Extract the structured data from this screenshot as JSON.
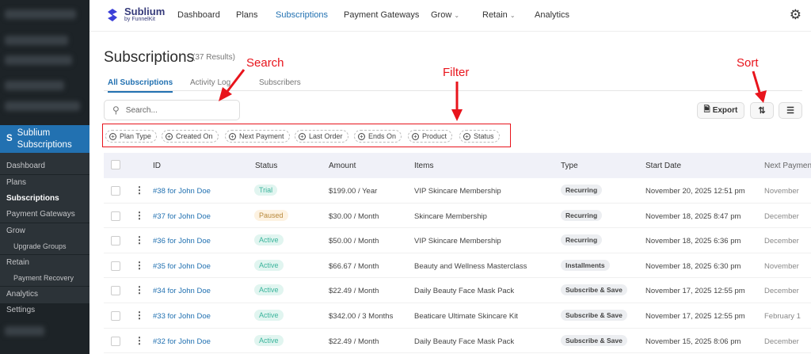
{
  "sidebar": {
    "active": "Sublium Subscriptions",
    "items": [
      "Dashboard",
      "Plans",
      "Subscriptions",
      "Payment Gateways",
      "Grow",
      "Upgrade Groups",
      "Retain",
      "Payment Recovery",
      "Analytics",
      "Settings"
    ]
  },
  "topbar": {
    "logo_name": "Sublium",
    "logo_sub": "by FunnelKit",
    "nav": [
      "Dashboard",
      "Plans",
      "Subscriptions",
      "Payment Gateways",
      "Grow",
      "Retain",
      "Analytics"
    ]
  },
  "page": {
    "title": "Subscriptions",
    "count": "(37 Results)",
    "tabs": [
      "All Subscriptions",
      "Activity Log",
      "Subscribers"
    ],
    "search_placeholder": "Search...",
    "export": "Export"
  },
  "filters": [
    "Plan Type",
    "Created On",
    "Next Payment",
    "Last Order",
    "Ends On",
    "Product",
    "Status"
  ],
  "annotations": {
    "search": "Search",
    "filter": "Filter",
    "sort": "Sort"
  },
  "table": {
    "headers": [
      "ID",
      "Status",
      "Amount",
      "Items",
      "Type",
      "Start Date",
      "Next Payment"
    ],
    "rows": [
      {
        "id": "#38 for John Doe",
        "status": "Trial",
        "amount": "$199.00 / Year",
        "items": "VIP Skincare Membership",
        "type": "Recurring",
        "start": "November 20, 2025 12:51 pm",
        "next": "November"
      },
      {
        "id": "#37 for John Doe",
        "status": "Paused",
        "amount": "$30.00 / Month",
        "items": "Skincare Membership",
        "type": "Recurring",
        "start": "November 18, 2025 8:47 pm",
        "next": "December"
      },
      {
        "id": "#36 for John Doe",
        "status": "Active",
        "amount": "$50.00 / Month",
        "items": "VIP Skincare Membership",
        "type": "Recurring",
        "start": "November 18, 2025 6:36 pm",
        "next": "December"
      },
      {
        "id": "#35 for John Doe",
        "status": "Active",
        "amount": "$66.67 / Month",
        "items": "Beauty and Wellness Masterclass",
        "type": "Installments",
        "start": "November 18, 2025 6:30 pm",
        "next": "November"
      },
      {
        "id": "#34 for John Doe",
        "status": "Active",
        "amount": "$22.49 / Month",
        "items": "Daily Beauty Face Mask Pack",
        "type": "Subscribe & Save",
        "start": "November 17, 2025 12:55 pm",
        "next": "December"
      },
      {
        "id": "#33 for John Doe",
        "status": "Active",
        "amount": "$342.00 / 3 Months",
        "items": "Beaticare Ultimate Skincare Kit",
        "type": "Subscribe & Save",
        "start": "November 17, 2025 12:55 pm",
        "next": "February 1"
      },
      {
        "id": "#32 for John Doe",
        "status": "Active",
        "amount": "$22.49 / Month",
        "items": "Daily Beauty Face Mask Pack",
        "type": "Subscribe & Save",
        "start": "November 15, 2025 8:06 pm",
        "next": "December"
      }
    ]
  }
}
